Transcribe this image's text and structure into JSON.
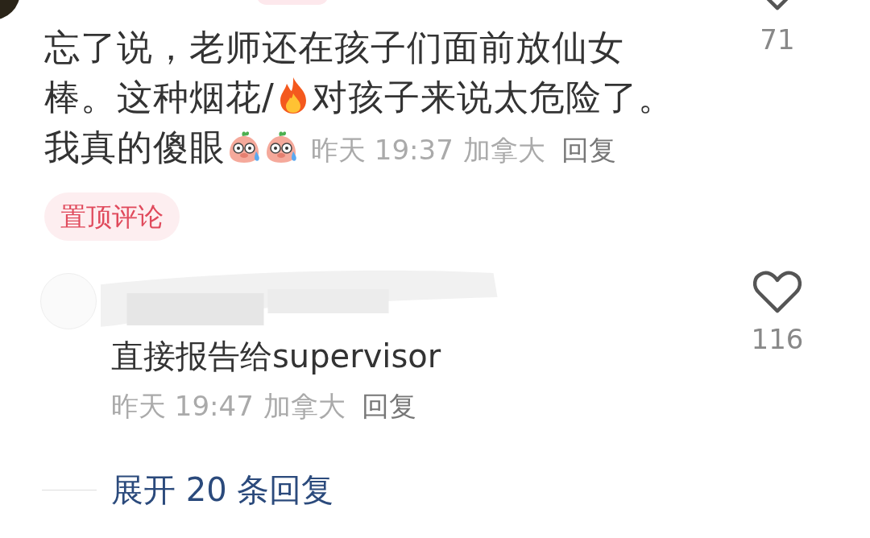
{
  "comment": {
    "body": [
      "忘了说，老师还在孩子们面前放仙女",
      "棒。这种烟花/",
      "对孩子来说太危险了。",
      "我真的傻眼"
    ],
    "time": "昨天 19:37",
    "location": "加拿大",
    "reply_label": "回复",
    "pinned_label": "置顶评论",
    "liked": false,
    "likes": "71",
    "replies": [
      {
        "body": "直接报告给supervisor",
        "time": "昨天 19:47",
        "location": "加拿大",
        "reply_label": "回复",
        "liked": false,
        "likes": "116"
      }
    ],
    "expand_label": "展开 20 条回复"
  }
}
